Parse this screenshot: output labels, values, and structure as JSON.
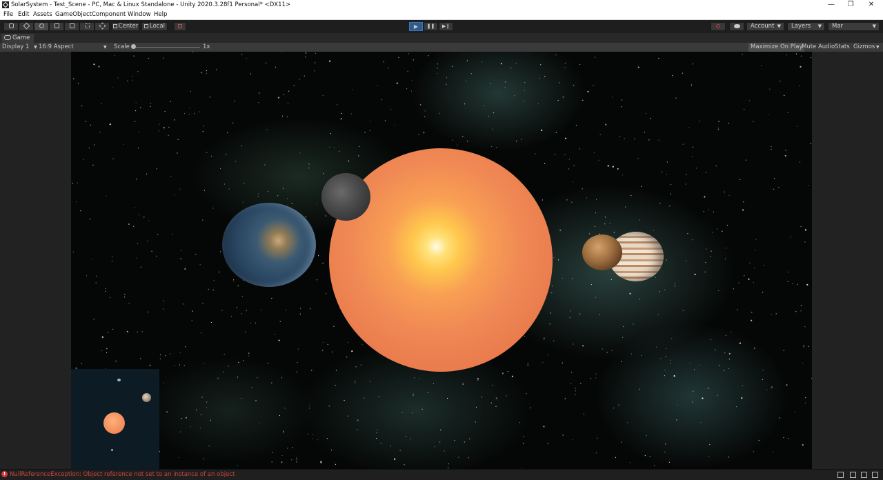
{
  "window": {
    "title": "SolarSystem - Test_Scene - PC, Mac & Linux Standalone - Unity 2020.3.28f1 Personal* <DX11>",
    "minimize": "—",
    "restore": "❐",
    "close": "✕"
  },
  "menu": [
    "File",
    "Edit",
    "Assets",
    "GameObject",
    "Component",
    "Window",
    "Help"
  ],
  "toolbar": {
    "tools": [
      "hand-icon",
      "move-icon",
      "rotate-icon",
      "scale-icon",
      "rect-icon",
      "transform-icon",
      "custom-tool-icon"
    ],
    "pivot_label": "Center",
    "space_label": "Local",
    "play": "▶",
    "pause": "❚❚",
    "step": "▶❙",
    "account_label": "Account",
    "layers_label": "Layers",
    "layout_label": "Mar"
  },
  "game_view": {
    "tab_label": "Game",
    "display_label": "Display 1",
    "aspect_label": "16:9 Aspect",
    "scale_label": "Scale",
    "scale_value": "1x",
    "maximize_label": "Maximize On Play",
    "mute_label": "Mute Audio",
    "stats_label": "Stats",
    "gizmos_label": "Gizmos"
  },
  "status": {
    "error_text": "NullReferenceException: Object reference not set to an instance of an object"
  },
  "colors": {
    "accent": "#3a78c0",
    "error": "#d43a3a"
  }
}
